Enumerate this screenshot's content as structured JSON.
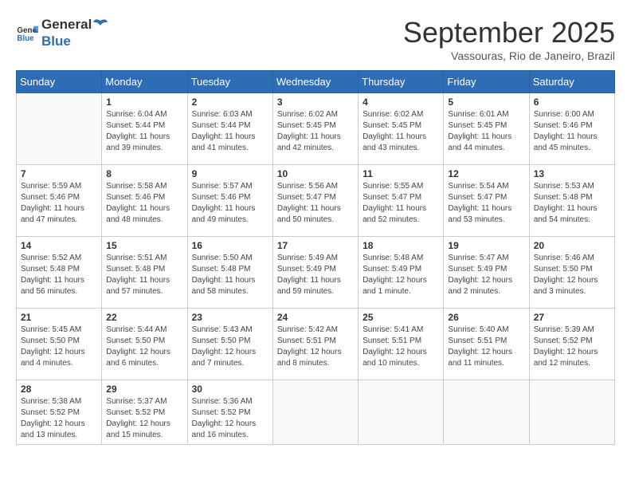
{
  "header": {
    "logo_general": "General",
    "logo_blue": "Blue",
    "month": "September 2025",
    "location": "Vassouras, Rio de Janeiro, Brazil"
  },
  "days_of_week": [
    "Sunday",
    "Monday",
    "Tuesday",
    "Wednesday",
    "Thursday",
    "Friday",
    "Saturday"
  ],
  "weeks": [
    [
      {
        "day": "",
        "info": ""
      },
      {
        "day": "1",
        "info": "Sunrise: 6:04 AM\nSunset: 5:44 PM\nDaylight: 11 hours\nand 39 minutes."
      },
      {
        "day": "2",
        "info": "Sunrise: 6:03 AM\nSunset: 5:44 PM\nDaylight: 11 hours\nand 41 minutes."
      },
      {
        "day": "3",
        "info": "Sunrise: 6:02 AM\nSunset: 5:45 PM\nDaylight: 11 hours\nand 42 minutes."
      },
      {
        "day": "4",
        "info": "Sunrise: 6:02 AM\nSunset: 5:45 PM\nDaylight: 11 hours\nand 43 minutes."
      },
      {
        "day": "5",
        "info": "Sunrise: 6:01 AM\nSunset: 5:45 PM\nDaylight: 11 hours\nand 44 minutes."
      },
      {
        "day": "6",
        "info": "Sunrise: 6:00 AM\nSunset: 5:46 PM\nDaylight: 11 hours\nand 45 minutes."
      }
    ],
    [
      {
        "day": "7",
        "info": "Sunrise: 5:59 AM\nSunset: 5:46 PM\nDaylight: 11 hours\nand 47 minutes."
      },
      {
        "day": "8",
        "info": "Sunrise: 5:58 AM\nSunset: 5:46 PM\nDaylight: 11 hours\nand 48 minutes."
      },
      {
        "day": "9",
        "info": "Sunrise: 5:57 AM\nSunset: 5:46 PM\nDaylight: 11 hours\nand 49 minutes."
      },
      {
        "day": "10",
        "info": "Sunrise: 5:56 AM\nSunset: 5:47 PM\nDaylight: 11 hours\nand 50 minutes."
      },
      {
        "day": "11",
        "info": "Sunrise: 5:55 AM\nSunset: 5:47 PM\nDaylight: 11 hours\nand 52 minutes."
      },
      {
        "day": "12",
        "info": "Sunrise: 5:54 AM\nSunset: 5:47 PM\nDaylight: 11 hours\nand 53 minutes."
      },
      {
        "day": "13",
        "info": "Sunrise: 5:53 AM\nSunset: 5:48 PM\nDaylight: 11 hours\nand 54 minutes."
      }
    ],
    [
      {
        "day": "14",
        "info": "Sunrise: 5:52 AM\nSunset: 5:48 PM\nDaylight: 11 hours\nand 56 minutes."
      },
      {
        "day": "15",
        "info": "Sunrise: 5:51 AM\nSunset: 5:48 PM\nDaylight: 11 hours\nand 57 minutes."
      },
      {
        "day": "16",
        "info": "Sunrise: 5:50 AM\nSunset: 5:48 PM\nDaylight: 11 hours\nand 58 minutes."
      },
      {
        "day": "17",
        "info": "Sunrise: 5:49 AM\nSunset: 5:49 PM\nDaylight: 11 hours\nand 59 minutes."
      },
      {
        "day": "18",
        "info": "Sunrise: 5:48 AM\nSunset: 5:49 PM\nDaylight: 12 hours\nand 1 minute."
      },
      {
        "day": "19",
        "info": "Sunrise: 5:47 AM\nSunset: 5:49 PM\nDaylight: 12 hours\nand 2 minutes."
      },
      {
        "day": "20",
        "info": "Sunrise: 5:46 AM\nSunset: 5:50 PM\nDaylight: 12 hours\nand 3 minutes."
      }
    ],
    [
      {
        "day": "21",
        "info": "Sunrise: 5:45 AM\nSunset: 5:50 PM\nDaylight: 12 hours\nand 4 minutes."
      },
      {
        "day": "22",
        "info": "Sunrise: 5:44 AM\nSunset: 5:50 PM\nDaylight: 12 hours\nand 6 minutes."
      },
      {
        "day": "23",
        "info": "Sunrise: 5:43 AM\nSunset: 5:50 PM\nDaylight: 12 hours\nand 7 minutes."
      },
      {
        "day": "24",
        "info": "Sunrise: 5:42 AM\nSunset: 5:51 PM\nDaylight: 12 hours\nand 8 minutes."
      },
      {
        "day": "25",
        "info": "Sunrise: 5:41 AM\nSunset: 5:51 PM\nDaylight: 12 hours\nand 10 minutes."
      },
      {
        "day": "26",
        "info": "Sunrise: 5:40 AM\nSunset: 5:51 PM\nDaylight: 12 hours\nand 11 minutes."
      },
      {
        "day": "27",
        "info": "Sunrise: 5:39 AM\nSunset: 5:52 PM\nDaylight: 12 hours\nand 12 minutes."
      }
    ],
    [
      {
        "day": "28",
        "info": "Sunrise: 5:38 AM\nSunset: 5:52 PM\nDaylight: 12 hours\nand 13 minutes."
      },
      {
        "day": "29",
        "info": "Sunrise: 5:37 AM\nSunset: 5:52 PM\nDaylight: 12 hours\nand 15 minutes."
      },
      {
        "day": "30",
        "info": "Sunrise: 5:36 AM\nSunset: 5:52 PM\nDaylight: 12 hours\nand 16 minutes."
      },
      {
        "day": "",
        "info": ""
      },
      {
        "day": "",
        "info": ""
      },
      {
        "day": "",
        "info": ""
      },
      {
        "day": "",
        "info": ""
      }
    ]
  ]
}
